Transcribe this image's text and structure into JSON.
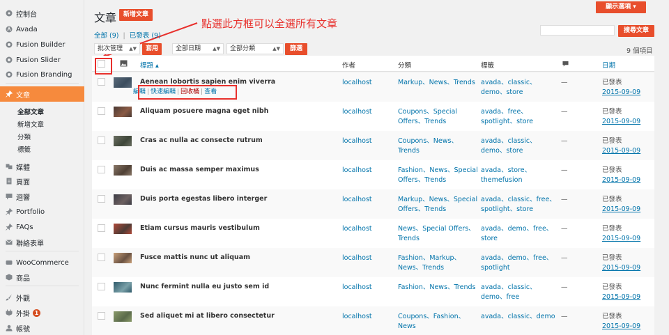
{
  "sidebar": {
    "items": [
      {
        "label": "控制台",
        "icon": "dashboard-icon"
      },
      {
        "label": "Avada",
        "icon": "avada-icon"
      },
      {
        "label": "Fusion Builder",
        "icon": "fusion-builder-icon"
      },
      {
        "label": "Fusion Slider",
        "icon": "fusion-slider-icon"
      },
      {
        "label": "Fusion Branding",
        "icon": "fusion-branding-icon"
      },
      {
        "label": "文章",
        "icon": "pin-icon"
      },
      {
        "label": "媒體",
        "icon": "media-icon"
      },
      {
        "label": "頁面",
        "icon": "page-icon"
      },
      {
        "label": "迴響",
        "icon": "comment-icon"
      },
      {
        "label": "Portfolio",
        "icon": "pin-icon"
      },
      {
        "label": "FAQs",
        "icon": "pin-icon"
      },
      {
        "label": "聯絡表單",
        "icon": "mail-icon"
      },
      {
        "label": "WooCommerce",
        "icon": "woocommerce-icon"
      },
      {
        "label": "商品",
        "icon": "product-icon"
      },
      {
        "label": "外觀",
        "icon": "brush-icon"
      },
      {
        "label": "外掛",
        "icon": "plugin-icon",
        "badge": "1"
      },
      {
        "label": "帳號",
        "icon": "user-icon"
      }
    ],
    "posts_sub": [
      "全部文章",
      "新增文章",
      "分類",
      "標籤"
    ]
  },
  "header": {
    "title": "文章",
    "add_new": "新增文章",
    "screen_options": "顯示選項 ▾",
    "search_button": "搜尋文章",
    "search_placeholder": ""
  },
  "filters": {
    "all": "全部",
    "all_count": "(9)",
    "published": "已發表",
    "published_count": "(9)",
    "bulk_action": "批次管理",
    "apply": "套用",
    "all_dates": "全部日期",
    "all_categories": "全部分類",
    "filter": "篩選",
    "items_count": "9 個項目"
  },
  "annotation": {
    "text": "點選此方框可以全選所有文章",
    "color": "#e8302c"
  },
  "table": {
    "headers": {
      "title": "標題 ▴",
      "author": "作者",
      "categories": "分類",
      "tags": "標籤",
      "date": "日期"
    },
    "row_actions": [
      "編輯",
      "快速編輯",
      "回收桶",
      "查看"
    ],
    "rows": [
      {
        "title": "Aenean lobortis sapien enim viverra",
        "author": "localhost",
        "categories": "Markup、News、Trends",
        "tags": "avada、classic、demo、store",
        "comments": "—",
        "status": "已發表",
        "date": "2015-09-09"
      },
      {
        "title": "Aliquam posuere magna eget nibh",
        "author": "localhost",
        "categories": "Coupons、Special Offers、Trends",
        "tags": "avada、free、spotlight、store",
        "comments": "—",
        "status": "已發表",
        "date": "2015-09-09"
      },
      {
        "title": "Cras ac nulla ac consecte rutrum",
        "author": "localhost",
        "categories": "Coupons、News、Trends",
        "tags": "avada、classic、demo、store",
        "comments": "—",
        "status": "已發表",
        "date": "2015-09-09"
      },
      {
        "title": "Duis ac massa semper maximus",
        "author": "localhost",
        "categories": "Fashion、News、Special Offers、Trends",
        "tags": "avada、store、themefusion",
        "comments": "—",
        "status": "已發表",
        "date": "2015-09-09"
      },
      {
        "title": "Duis porta egestas libero interger",
        "author": "localhost",
        "categories": "Markup、News、Special Offers、Trends",
        "tags": "avada、classic、free、spotlight、store",
        "comments": "—",
        "status": "已發表",
        "date": "2015-09-09"
      },
      {
        "title": "Etiam cursus mauris vestibulum",
        "author": "localhost",
        "categories": "News、Special Offers、Trends",
        "tags": "avada、demo、free、store",
        "comments": "—",
        "status": "已發表",
        "date": "2015-09-09"
      },
      {
        "title": "Fusce mattis nunc ut aliquam",
        "author": "localhost",
        "categories": "Fashion、Markup、News、Trends",
        "tags": "avada、demo、free、spotlight",
        "comments": "—",
        "status": "已發表",
        "date": "2015-09-09"
      },
      {
        "title": "Nunc fermint nulla eu justo sem id",
        "author": "localhost",
        "categories": "Fashion、News、Trends",
        "tags": "avada、classic、demo、free",
        "comments": "—",
        "status": "已發表",
        "date": "2015-09-09"
      },
      {
        "title": "Sed aliquet mi at libero consectetur",
        "author": "localhost",
        "categories": "Coupons、Fashion、News",
        "tags": "avada、classic、demo",
        "comments": "—",
        "status": "已發表",
        "date": "2015-09-09"
      }
    ]
  },
  "colors": {
    "accent": "#f68a3d",
    "button_red": "#e84e2c",
    "link": "#0073aa",
    "highlight": "#e8302c"
  }
}
